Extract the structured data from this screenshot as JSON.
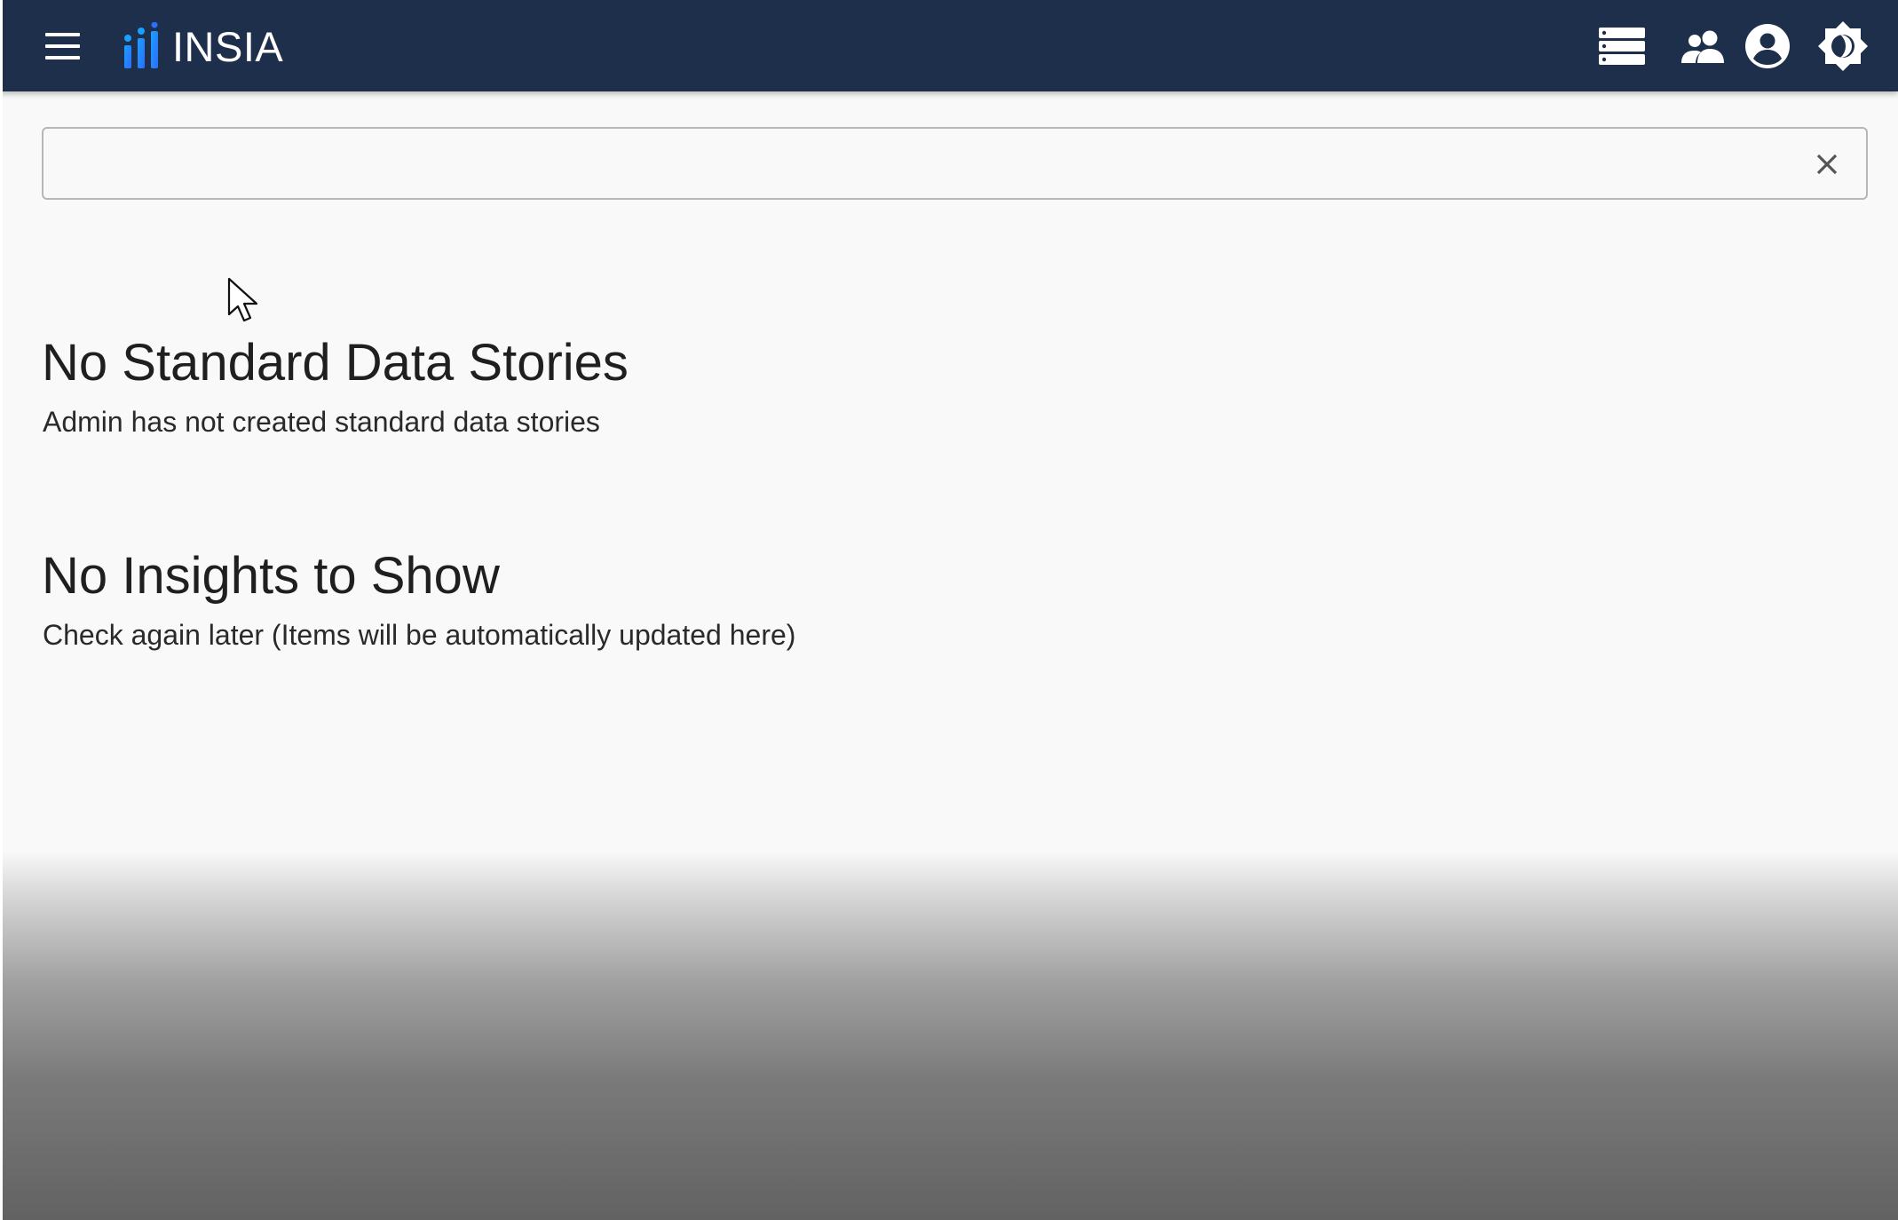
{
  "app": {
    "brand": "INSIA",
    "colors": {
      "topbar": "#1e2f4b",
      "logo_gradient_start": "#1aa0ff",
      "logo_gradient_end": "#2d6dff",
      "background": "#f9f9f9"
    }
  },
  "header": {
    "icons": [
      "menu-icon",
      "database-icon",
      "people-icon",
      "account-circle-icon",
      "brightness-icon"
    ]
  },
  "search": {
    "value": "",
    "placeholder": "",
    "clear_icon": "close-icon"
  },
  "sections": [
    {
      "title": "No Standard Data Stories",
      "subtitle": "Admin has not created standard data stories"
    },
    {
      "title": "No Insights to Show",
      "subtitle": "Check again later (Items will be automatically updated here)"
    }
  ]
}
